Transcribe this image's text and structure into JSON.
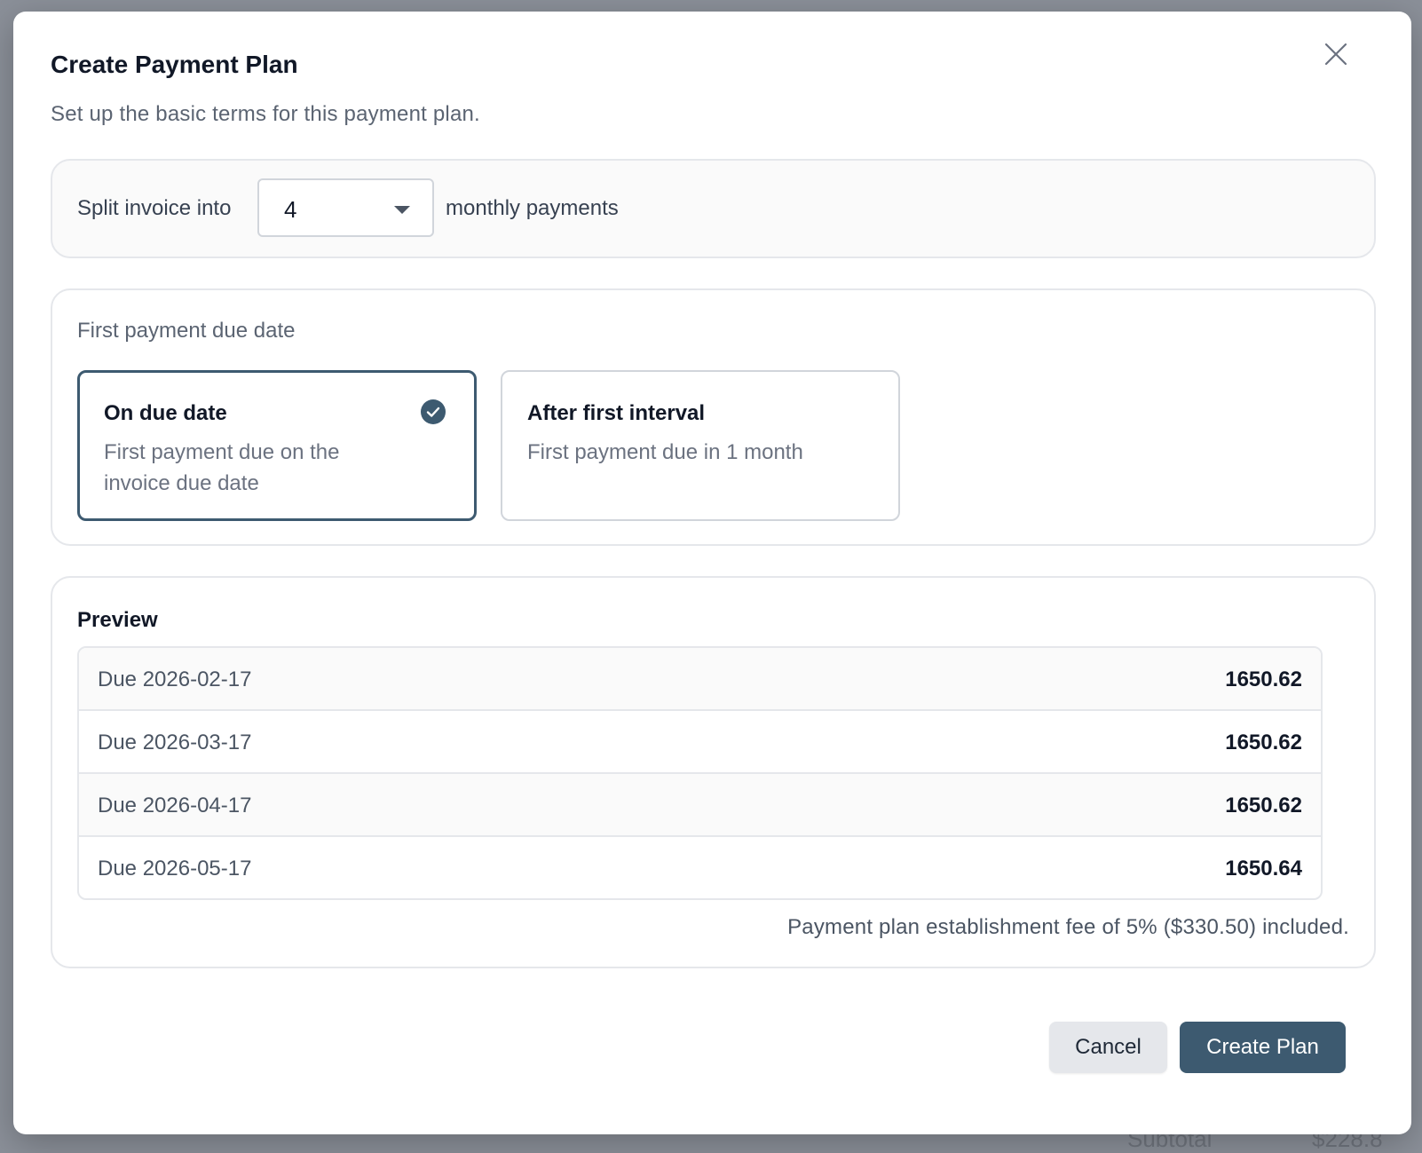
{
  "modal": {
    "title": "Create Payment Plan",
    "subtitle": "Set up the basic terms for this payment plan.",
    "close_icon": "close-icon"
  },
  "split": {
    "label": "Split invoice into",
    "selected_value": "4",
    "suffix": "monthly payments"
  },
  "first_payment": {
    "label": "First payment due date",
    "options": [
      {
        "title": "On due date",
        "description": "First payment due on the invoice due date",
        "selected": true
      },
      {
        "title": "After first interval",
        "description": "First payment due in 1 month",
        "selected": false
      }
    ]
  },
  "preview": {
    "title": "Preview",
    "rows": [
      {
        "date": "Due 2026-02-17",
        "amount": "1650.62"
      },
      {
        "date": "Due 2026-03-17",
        "amount": "1650.62"
      },
      {
        "date": "Due 2026-04-17",
        "amount": "1650.62"
      },
      {
        "date": "Due 2026-05-17",
        "amount": "1650.64"
      }
    ],
    "fee_note": "Payment plan establishment fee of 5% ($330.50) included."
  },
  "actions": {
    "cancel_label": "Cancel",
    "create_label": "Create Plan"
  },
  "background": {
    "subtotal_label": "Subtotal",
    "subtotal_value": "$228.8"
  },
  "colors": {
    "accent": "#3d5a70",
    "overlay": "#8b9099",
    "border": "#e5e7eb"
  }
}
